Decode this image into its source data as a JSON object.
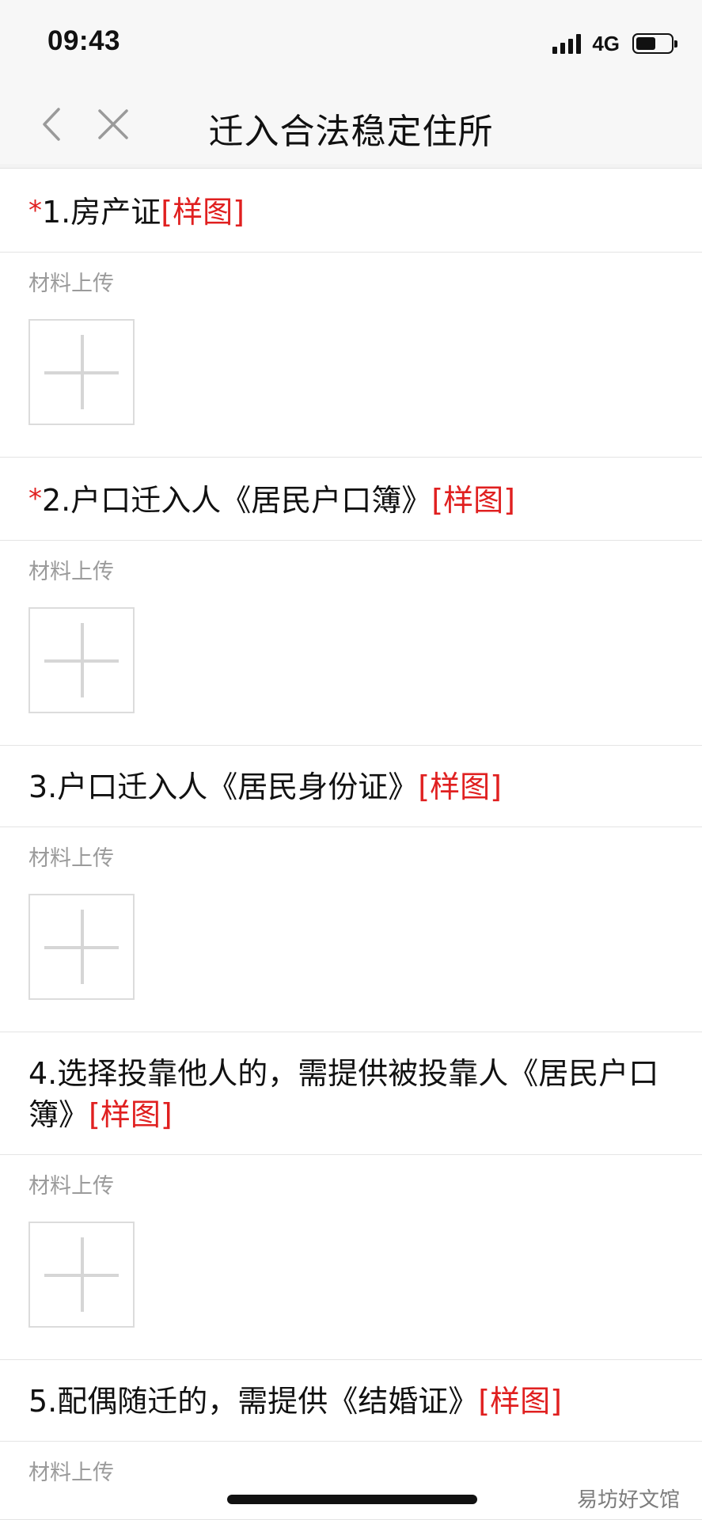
{
  "status_bar": {
    "time": "09:43",
    "network": "4G",
    "battery_level": 0.6
  },
  "nav": {
    "title": "迁入合法稳定住所",
    "back_icon": "chevron-left-icon",
    "close_icon": "close-icon"
  },
  "sections": [
    {
      "required_mark": "*",
      "title": "1.房产证",
      "sample_label": "[样图]",
      "upload_label": "材料上传"
    },
    {
      "required_mark": "*",
      "title": "2.户口迁入人《居民户口簿》",
      "sample_label": "[样图]",
      "upload_label": "材料上传"
    },
    {
      "required_mark": "",
      "title": "3.户口迁入人《居民身份证》",
      "sample_label": "[样图]",
      "upload_label": "材料上传"
    },
    {
      "required_mark": "",
      "title": "4.选择投靠他人的，需提供被投靠人《居民户口簿》",
      "sample_label": "[样图]",
      "upload_label": "材料上传"
    },
    {
      "required_mark": "",
      "title": "5.配偶随迁的，需提供《结婚证》",
      "sample_label": "[样图]",
      "upload_label": "材料上传"
    }
  ],
  "watermark": "易坊好文馆",
  "colors": {
    "accent": "#e02020",
    "label_gray": "#9b9b9b",
    "divider": "#e4e4e4"
  }
}
